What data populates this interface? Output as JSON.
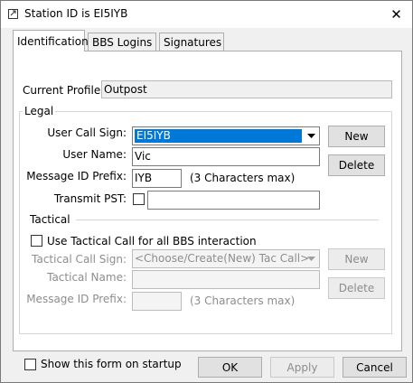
{
  "window": {
    "title": "Station ID is EI5IYB",
    "close": "✕"
  },
  "tabs": [
    {
      "label": "Identification",
      "active": true
    },
    {
      "label": "BBS Logins",
      "active": false
    },
    {
      "label": "Signatures",
      "active": false
    }
  ],
  "profile": {
    "label": "Current Profile:",
    "value": "Outpost"
  },
  "legal": {
    "group_label": "Legal",
    "user_call_sign_label": "User Call Sign:",
    "user_call_sign_value": "EI5IYB",
    "user_name_label": "User Name:",
    "user_name_value": "Vic",
    "msg_id_prefix_label": "Message ID Prefix:",
    "msg_id_prefix_value": "IYB",
    "msg_id_hint": "(3 Characters max)",
    "transmit_pst_label": "Transmit PST:",
    "transmit_pst_checked": false,
    "transmit_pst_value": "",
    "new_button": "New",
    "delete_button": "Delete"
  },
  "tactical": {
    "group_label": "Tactical",
    "use_tactical_label": "Use Tactical Call for all BBS interaction",
    "use_tactical_checked": false,
    "call_sign_label": "Tactical Call Sign:",
    "call_sign_value": "<Choose/Create(New) Tac Call>",
    "name_label": "Tactical Name:",
    "name_value": "",
    "msg_id_prefix_label": "Message ID Prefix:",
    "msg_id_prefix_value": "",
    "msg_id_hint": "(3 Characters max)",
    "new_button": "New",
    "delete_button": "Delete"
  },
  "footer": {
    "show_on_startup_label": "Show this form on startup",
    "show_on_startup_checked": false,
    "ok_button": "OK",
    "apply_button": "Apply",
    "cancel_button": "Cancel"
  },
  "colors": {
    "selection": "#0078d7",
    "disabled_text": "#8d8d8d"
  }
}
